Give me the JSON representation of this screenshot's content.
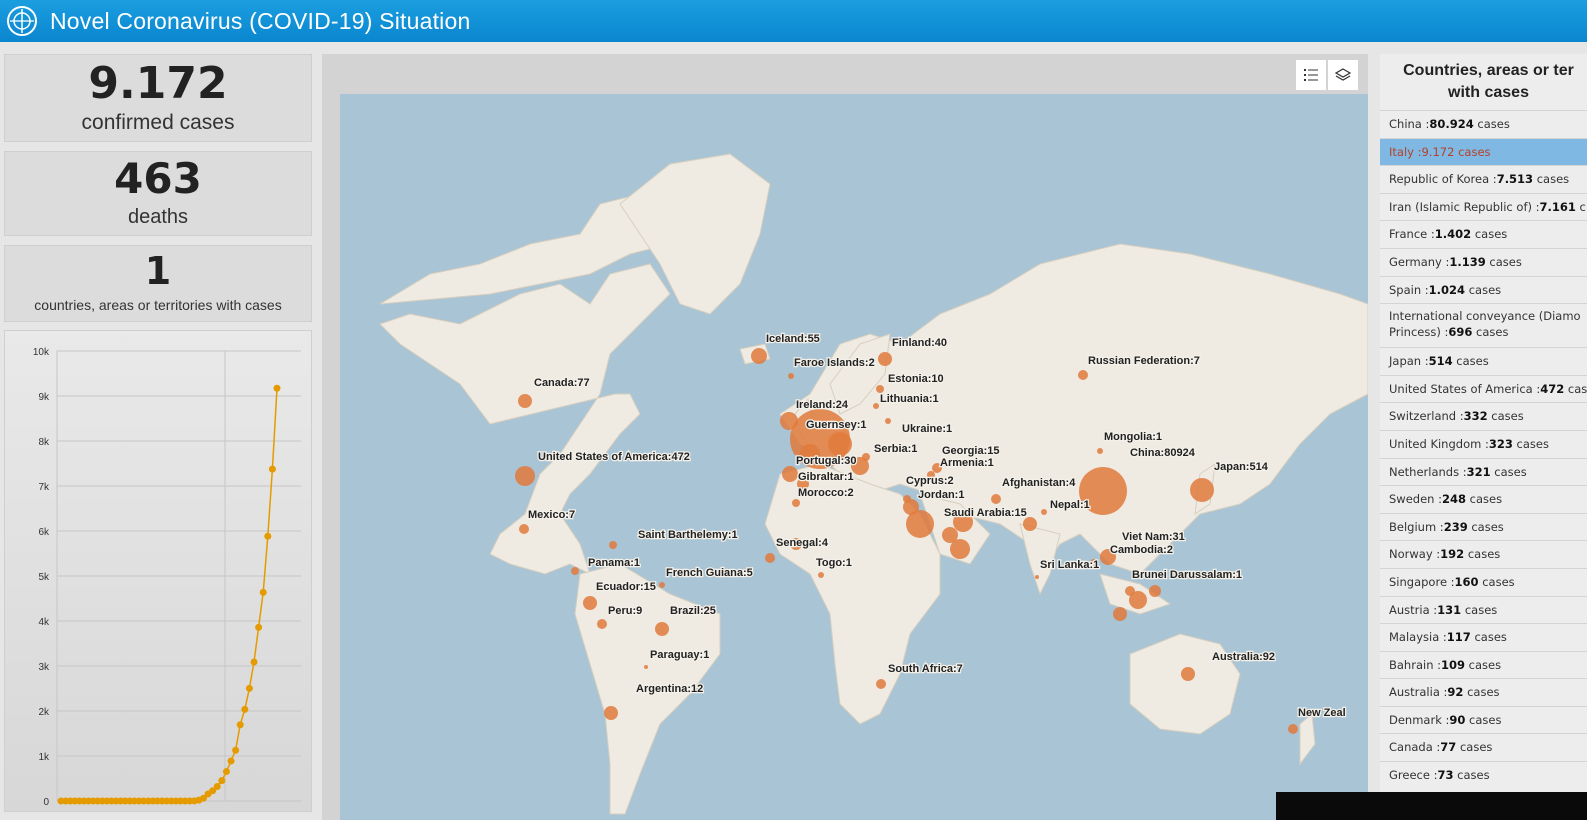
{
  "app": {
    "title": "Novel Coronavirus (COVID-19) Situation"
  },
  "stats": {
    "confirmed": {
      "value": "9.172",
      "label": "confirmed cases"
    },
    "deaths": {
      "value": "463",
      "label": "deaths"
    },
    "countries": {
      "value": "1",
      "label": "countries, areas or territories with cases"
    }
  },
  "chart_data": {
    "type": "line",
    "yticks": [
      "0",
      "1k",
      "2k",
      "3k",
      "4k",
      "5k",
      "6k",
      "7k",
      "8k",
      "9k",
      "10k"
    ],
    "ylim": [
      0,
      10000
    ],
    "values": [
      0,
      0,
      0,
      0,
      0,
      0,
      0,
      0,
      0,
      0,
      0,
      0,
      0,
      0,
      0,
      0,
      0,
      0,
      0,
      0,
      0,
      0,
      0,
      0,
      0,
      0,
      0,
      0,
      0,
      3,
      20,
      62,
      155,
      229,
      322,
      453,
      655,
      888,
      1128,
      1694,
      2036,
      2502,
      3089,
      3858,
      4636,
      5883,
      7375,
      9172
    ]
  },
  "map": {
    "labels": [
      {
        "text": "Iceland:55"
      },
      {
        "text": "Faroe Islands:2"
      },
      {
        "text": "Finland:40"
      },
      {
        "text": "Russian Federation:7"
      },
      {
        "text": "Estonia:10"
      },
      {
        "text": "Lithuania:1"
      },
      {
        "text": "Canada:77"
      },
      {
        "text": "Ireland:24"
      },
      {
        "text": "Guernsey:1"
      },
      {
        "text": "Ukraine:1"
      },
      {
        "text": "Mongolia:1"
      },
      {
        "text": "Serbia:1"
      },
      {
        "text": "Georgia:15"
      },
      {
        "text": "Armenia:1"
      },
      {
        "text": "China:80924"
      },
      {
        "text": "Japan:514"
      },
      {
        "text": "United States of America:472"
      },
      {
        "text": "Portugal:30"
      },
      {
        "text": "Gibraltar:1"
      },
      {
        "text": "Cyprus:2"
      },
      {
        "text": "Afghanistan:4"
      },
      {
        "text": "Jordan:1"
      },
      {
        "text": "Morocco:2"
      },
      {
        "text": "Saudi Arabia:15"
      },
      {
        "text": "Nepal:1"
      },
      {
        "text": "Mexico:7"
      },
      {
        "text": "Saint Barthelemy:1"
      },
      {
        "text": "Viet Nam:31"
      },
      {
        "text": "Senegal:4"
      },
      {
        "text": "Cambodia:2"
      },
      {
        "text": "Panama:1"
      },
      {
        "text": "Togo:1"
      },
      {
        "text": "Sri Lanka:1"
      },
      {
        "text": "Brunei Darussalam:1"
      },
      {
        "text": "French Guiana:5"
      },
      {
        "text": "Ecuador:15"
      },
      {
        "text": "Peru:9"
      },
      {
        "text": "Brazil:25"
      },
      {
        "text": "Paraguay:1"
      },
      {
        "text": "South Africa:7"
      },
      {
        "text": "Australia:92"
      },
      {
        "text": "Argentina:12"
      },
      {
        "text": "New Zeal"
      }
    ]
  },
  "list": {
    "title": "Countries, areas or ter with cases",
    "items": [
      {
        "name": "China :",
        "count": "80.924",
        "unit": " cases"
      },
      {
        "name": "Italy :",
        "count": "9.172",
        "unit": " cases"
      },
      {
        "name": "Republic of Korea :",
        "count": "7.513",
        "unit": " cases"
      },
      {
        "name": "Iran (Islamic Republic of) :",
        "count": "7.161",
        "unit": " c"
      },
      {
        "name": "France :",
        "count": "1.402",
        "unit": " cases"
      },
      {
        "name": "Germany :",
        "count": "1.139",
        "unit": " cases"
      },
      {
        "name": "Spain :",
        "count": "1.024",
        "unit": " cases"
      },
      {
        "name": "International conveyance (Diamo Princess) :",
        "count": "696",
        "unit": " cases"
      },
      {
        "name": "Japan :",
        "count": "514",
        "unit": " cases"
      },
      {
        "name": "United States of America :",
        "count": "472",
        "unit": " cas"
      },
      {
        "name": "Switzerland :",
        "count": "332",
        "unit": " cases"
      },
      {
        "name": "United Kingdom :",
        "count": "323",
        "unit": " cases"
      },
      {
        "name": "Netherlands :",
        "count": "321",
        "unit": " cases"
      },
      {
        "name": "Sweden :",
        "count": "248",
        "unit": " cases"
      },
      {
        "name": "Belgium :",
        "count": "239",
        "unit": " cases"
      },
      {
        "name": "Norway :",
        "count": "192",
        "unit": " cases"
      },
      {
        "name": "Singapore :",
        "count": "160",
        "unit": " cases"
      },
      {
        "name": "Austria :",
        "count": "131",
        "unit": " cases"
      },
      {
        "name": "Malaysia :",
        "count": "117",
        "unit": " cases"
      },
      {
        "name": "Bahrain :",
        "count": "109",
        "unit": " cases"
      },
      {
        "name": "Australia :",
        "count": "92",
        "unit": " cases"
      },
      {
        "name": "Denmark :",
        "count": "90",
        "unit": " cases"
      },
      {
        "name": "Canada :",
        "count": "77",
        "unit": " cases"
      },
      {
        "name": "Greece :",
        "count": "73",
        "unit": " cases"
      }
    ]
  },
  "colors": {
    "accent": "#0a86cf",
    "bubble": "#e07a3c",
    "line": "#e59b00",
    "selected": "#7fb9e3"
  }
}
